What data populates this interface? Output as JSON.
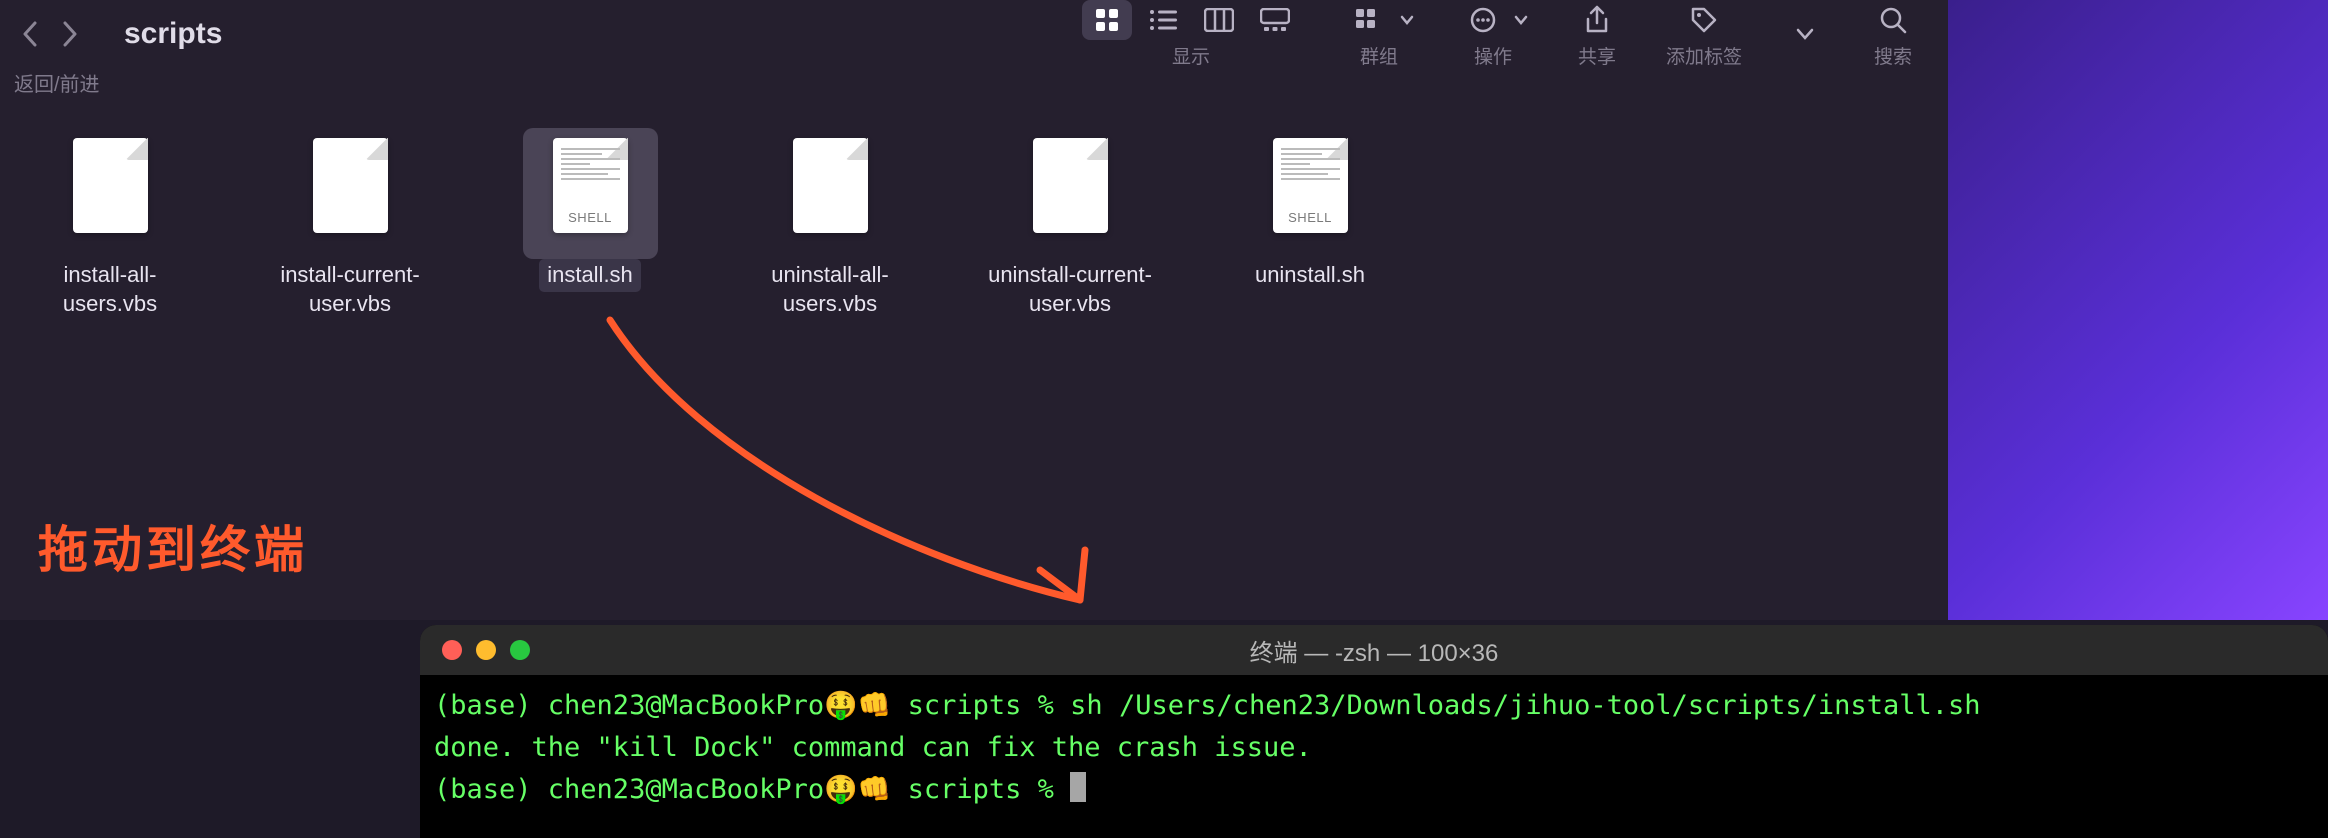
{
  "finder": {
    "title": "scripts",
    "nav_label": "返回/前进",
    "labels": {
      "view": "显示",
      "group": "群组",
      "action": "操作",
      "share": "共享",
      "tags": "添加标签",
      "search": "搜索"
    },
    "files": [
      {
        "name": "install-all-users.vbs",
        "type": "plain",
        "selected": false
      },
      {
        "name": "install-current-user.vbs",
        "type": "plain",
        "selected": false
      },
      {
        "name": "install.sh",
        "type": "shell",
        "selected": true
      },
      {
        "name": "uninstall-all-users.vbs",
        "type": "plain",
        "selected": false
      },
      {
        "name": "uninstall-current-user.vbs",
        "type": "plain",
        "selected": false
      },
      {
        "name": "uninstall.sh",
        "type": "shell",
        "selected": false
      }
    ]
  },
  "annotation": {
    "text": "拖动到终端",
    "color": "#ff5a2c"
  },
  "terminal": {
    "title": "终端 — -zsh — 100×36",
    "lines": [
      "(base) chen23@MacBookPro🤑👊 scripts % sh /Users/chen23/Downloads/jihuo-tool/scripts/install.sh",
      "done. the \"kill Dock\" command can fix the crash issue.",
      "(base) chen23@MacBookPro🤑👊 scripts % "
    ]
  }
}
